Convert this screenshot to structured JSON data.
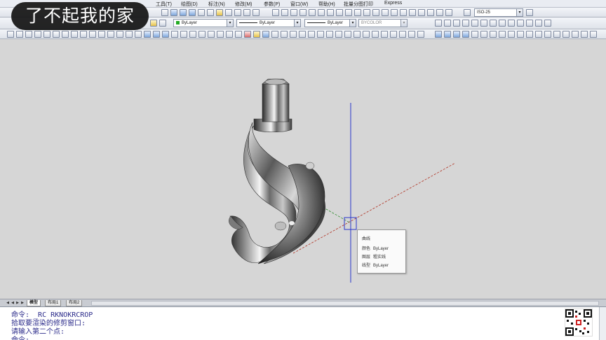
{
  "overlay_title": "了不起我的家",
  "menu": {
    "items": [
      "工具(T)",
      "绘图(D)",
      "标注(N)",
      "修改(M)",
      "参数(P)",
      "窗口(W)",
      "帮助(H)",
      "批量分图打印",
      "Express"
    ]
  },
  "toolbar": {
    "dimstyle": "ISO-25",
    "layer_color": "ByLayer",
    "linetype": "ByLayer",
    "lineweight": "ByLayer",
    "plotstyle": "BYCOLOR"
  },
  "tooltip": {
    "title": "曲线",
    "rows": [
      {
        "key": "颜色",
        "value": "ByLayer"
      },
      {
        "key": "图层",
        "value": "粗实线"
      },
      {
        "key": "线型",
        "value": "ByLayer"
      }
    ]
  },
  "layout_tabs": [
    "模型",
    "布局1",
    "布局2"
  ],
  "command": {
    "lines": [
      "命令: _RC RKNOKRCROP",
      "拾取要渲染的修剪窗口:",
      "请输入第二个点:",
      "命令:"
    ]
  },
  "colors": {
    "viewport_bg": "#d6d6d6",
    "ucs_blue": "#2a36c9",
    "ucs_red": "#b03020",
    "ucs_green": "#2a8a2a",
    "command_text": "#2b2b8a"
  }
}
